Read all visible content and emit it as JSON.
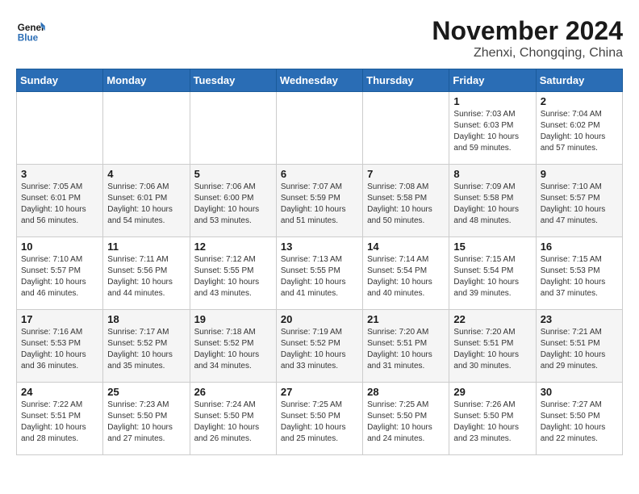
{
  "header": {
    "logo_general": "General",
    "logo_blue": "Blue",
    "month_title": "November 2024",
    "subtitle": "Zhenxi, Chongqing, China"
  },
  "weekdays": [
    "Sunday",
    "Monday",
    "Tuesday",
    "Wednesday",
    "Thursday",
    "Friday",
    "Saturday"
  ],
  "weeks": [
    [
      {
        "day": "",
        "info": ""
      },
      {
        "day": "",
        "info": ""
      },
      {
        "day": "",
        "info": ""
      },
      {
        "day": "",
        "info": ""
      },
      {
        "day": "",
        "info": ""
      },
      {
        "day": "1",
        "info": "Sunrise: 7:03 AM\nSunset: 6:03 PM\nDaylight: 10 hours and 59 minutes."
      },
      {
        "day": "2",
        "info": "Sunrise: 7:04 AM\nSunset: 6:02 PM\nDaylight: 10 hours and 57 minutes."
      }
    ],
    [
      {
        "day": "3",
        "info": "Sunrise: 7:05 AM\nSunset: 6:01 PM\nDaylight: 10 hours and 56 minutes."
      },
      {
        "day": "4",
        "info": "Sunrise: 7:06 AM\nSunset: 6:01 PM\nDaylight: 10 hours and 54 minutes."
      },
      {
        "day": "5",
        "info": "Sunrise: 7:06 AM\nSunset: 6:00 PM\nDaylight: 10 hours and 53 minutes."
      },
      {
        "day": "6",
        "info": "Sunrise: 7:07 AM\nSunset: 5:59 PM\nDaylight: 10 hours and 51 minutes."
      },
      {
        "day": "7",
        "info": "Sunrise: 7:08 AM\nSunset: 5:58 PM\nDaylight: 10 hours and 50 minutes."
      },
      {
        "day": "8",
        "info": "Sunrise: 7:09 AM\nSunset: 5:58 PM\nDaylight: 10 hours and 48 minutes."
      },
      {
        "day": "9",
        "info": "Sunrise: 7:10 AM\nSunset: 5:57 PM\nDaylight: 10 hours and 47 minutes."
      }
    ],
    [
      {
        "day": "10",
        "info": "Sunrise: 7:10 AM\nSunset: 5:57 PM\nDaylight: 10 hours and 46 minutes."
      },
      {
        "day": "11",
        "info": "Sunrise: 7:11 AM\nSunset: 5:56 PM\nDaylight: 10 hours and 44 minutes."
      },
      {
        "day": "12",
        "info": "Sunrise: 7:12 AM\nSunset: 5:55 PM\nDaylight: 10 hours and 43 minutes."
      },
      {
        "day": "13",
        "info": "Sunrise: 7:13 AM\nSunset: 5:55 PM\nDaylight: 10 hours and 41 minutes."
      },
      {
        "day": "14",
        "info": "Sunrise: 7:14 AM\nSunset: 5:54 PM\nDaylight: 10 hours and 40 minutes."
      },
      {
        "day": "15",
        "info": "Sunrise: 7:15 AM\nSunset: 5:54 PM\nDaylight: 10 hours and 39 minutes."
      },
      {
        "day": "16",
        "info": "Sunrise: 7:15 AM\nSunset: 5:53 PM\nDaylight: 10 hours and 37 minutes."
      }
    ],
    [
      {
        "day": "17",
        "info": "Sunrise: 7:16 AM\nSunset: 5:53 PM\nDaylight: 10 hours and 36 minutes."
      },
      {
        "day": "18",
        "info": "Sunrise: 7:17 AM\nSunset: 5:52 PM\nDaylight: 10 hours and 35 minutes."
      },
      {
        "day": "19",
        "info": "Sunrise: 7:18 AM\nSunset: 5:52 PM\nDaylight: 10 hours and 34 minutes."
      },
      {
        "day": "20",
        "info": "Sunrise: 7:19 AM\nSunset: 5:52 PM\nDaylight: 10 hours and 33 minutes."
      },
      {
        "day": "21",
        "info": "Sunrise: 7:20 AM\nSunset: 5:51 PM\nDaylight: 10 hours and 31 minutes."
      },
      {
        "day": "22",
        "info": "Sunrise: 7:20 AM\nSunset: 5:51 PM\nDaylight: 10 hours and 30 minutes."
      },
      {
        "day": "23",
        "info": "Sunrise: 7:21 AM\nSunset: 5:51 PM\nDaylight: 10 hours and 29 minutes."
      }
    ],
    [
      {
        "day": "24",
        "info": "Sunrise: 7:22 AM\nSunset: 5:51 PM\nDaylight: 10 hours and 28 minutes."
      },
      {
        "day": "25",
        "info": "Sunrise: 7:23 AM\nSunset: 5:50 PM\nDaylight: 10 hours and 27 minutes."
      },
      {
        "day": "26",
        "info": "Sunrise: 7:24 AM\nSunset: 5:50 PM\nDaylight: 10 hours and 26 minutes."
      },
      {
        "day": "27",
        "info": "Sunrise: 7:25 AM\nSunset: 5:50 PM\nDaylight: 10 hours and 25 minutes."
      },
      {
        "day": "28",
        "info": "Sunrise: 7:25 AM\nSunset: 5:50 PM\nDaylight: 10 hours and 24 minutes."
      },
      {
        "day": "29",
        "info": "Sunrise: 7:26 AM\nSunset: 5:50 PM\nDaylight: 10 hours and 23 minutes."
      },
      {
        "day": "30",
        "info": "Sunrise: 7:27 AM\nSunset: 5:50 PM\nDaylight: 10 hours and 22 minutes."
      }
    ]
  ],
  "colors": {
    "header_bg": "#2a6db5",
    "accent": "#2a6db5"
  }
}
